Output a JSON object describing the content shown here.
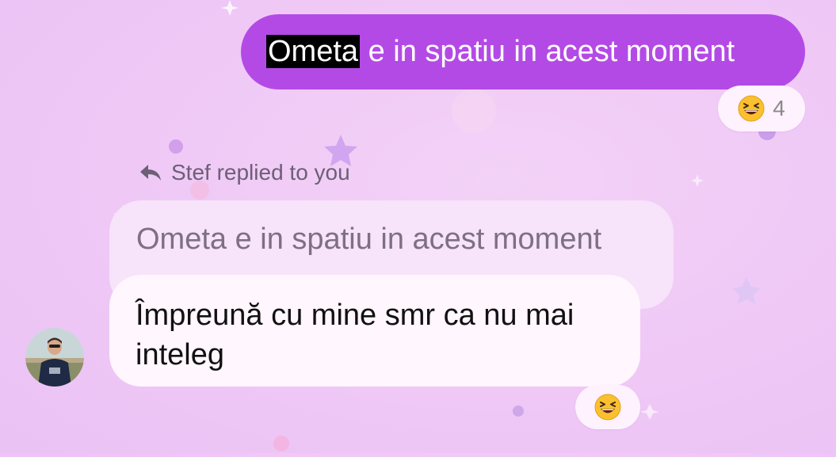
{
  "colors": {
    "background": "#efc8f6",
    "sent_bubble": "#b44ae6",
    "quoted_bubble": "#f7e3fa",
    "received_bubble": "#fff6fe",
    "highlight": "#000000"
  },
  "sent_message": {
    "highlighted_word": "Ometa",
    "rest_text": " e in spatiu in acest moment",
    "reaction": {
      "icon": "laughing-face-emoji",
      "count": "4"
    }
  },
  "reply_indicator": {
    "icon": "reply-arrow-icon",
    "label": "Stef replied to you"
  },
  "quoted_message": {
    "text": "Ometa e in spatiu in acest moment"
  },
  "received_message": {
    "line1": "Împreună cu mine smr ca nu mai",
    "line2": "inteleg",
    "reaction": {
      "icon": "laughing-face-emoji"
    },
    "avatar": "sender-avatar"
  }
}
